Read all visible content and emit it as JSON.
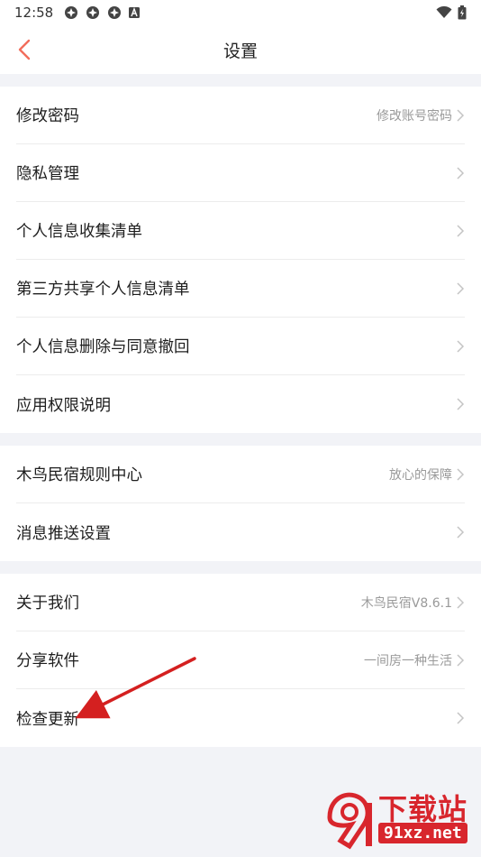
{
  "status_bar": {
    "time": "12:58",
    "icons": [
      "pinwheel-icon",
      "pinwheel-icon",
      "pinwheel-icon",
      "a-box-icon"
    ],
    "right_icons": [
      "wifi-icon",
      "battery-icon"
    ]
  },
  "nav": {
    "title": "设置",
    "back_icon": "chevron-left-icon",
    "accent": "#f26d5b"
  },
  "groups": [
    {
      "items": [
        {
          "label": "修改密码",
          "value": "修改账号密码"
        },
        {
          "label": "隐私管理",
          "value": ""
        },
        {
          "label": "个人信息收集清单",
          "value": ""
        },
        {
          "label": "第三方共享个人信息清单",
          "value": ""
        },
        {
          "label": "个人信息删除与同意撤回",
          "value": ""
        },
        {
          "label": "应用权限说明",
          "value": ""
        }
      ]
    },
    {
      "items": [
        {
          "label": "木鸟民宿规则中心",
          "value": "放心的保障"
        },
        {
          "label": "消息推送设置",
          "value": ""
        }
      ]
    },
    {
      "items": [
        {
          "label": "关于我们",
          "value": "木鸟民宿V8.6.1"
        },
        {
          "label": "分享软件",
          "value": "一间房一种生活"
        },
        {
          "label": "检查更新",
          "value": ""
        }
      ]
    }
  ],
  "watermark": {
    "title": "下载站",
    "domain": "91xz.net",
    "color": "#d8262d"
  },
  "annotation_color": "#d42020"
}
